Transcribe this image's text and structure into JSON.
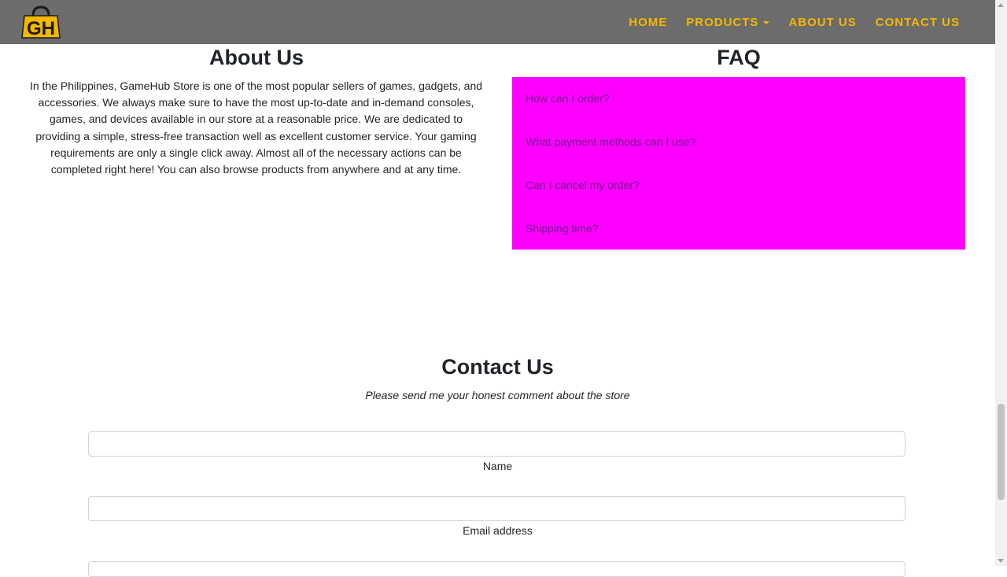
{
  "nav": {
    "logo_text": "GH",
    "items": [
      {
        "label": "HOME",
        "dropdown": false
      },
      {
        "label": "PRODUCTS",
        "dropdown": true
      },
      {
        "label": "ABOUT US",
        "dropdown": false
      },
      {
        "label": "CONTACT US",
        "dropdown": false
      }
    ],
    "colors": {
      "bar": "#6c6c6c",
      "accent": "#f5b800"
    }
  },
  "about": {
    "title": "About Us",
    "text": "In the Philippines, GameHub Store is one of the most popular sellers of games, gadgets, and accessories. We always make sure to have the most up-to-date and in-demand consoles, games, and devices available in our store at a reasonable price. We are dedicated to providing a simple, stress-free transaction well as excellent customer service. Your gaming requirements are only a single click away. Almost all of the necessary actions can be completed right here! You can also browse products from anywhere and at any time."
  },
  "faq": {
    "title": "FAQ",
    "background": "#ff00ff",
    "items": [
      "How can I order?",
      "What payment methods can I use?",
      "Can I cancel my order?",
      "Shipping time?"
    ]
  },
  "contact": {
    "title": "Contact Us",
    "subtitle": "Please send me your honest comment about the store",
    "fields": [
      {
        "label": "Name",
        "value": "",
        "placeholder": ""
      },
      {
        "label": "Email address",
        "value": "",
        "placeholder": ""
      }
    ]
  }
}
